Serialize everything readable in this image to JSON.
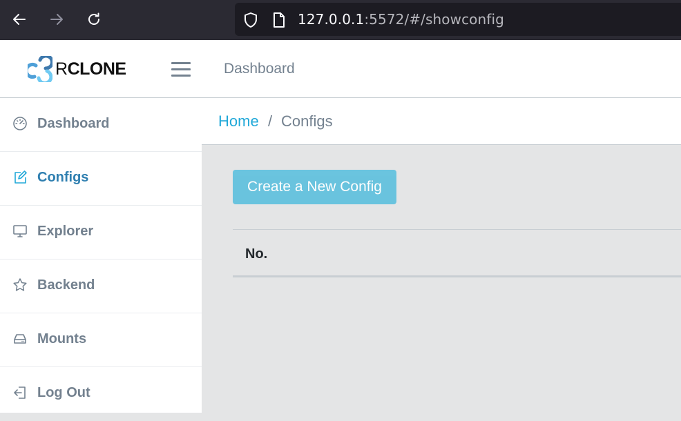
{
  "browser": {
    "url_host": "127.0.0.1",
    "url_rest": ":5572/#/showconfig"
  },
  "header": {
    "brand": {
      "prefix": "R",
      "rest": "CLONE"
    },
    "nav_link": "Dashboard"
  },
  "sidebar": {
    "items": [
      {
        "label": "Dashboard",
        "icon": "speedometer-icon"
      },
      {
        "label": "Configs",
        "icon": "pencil-square-icon",
        "active": true
      },
      {
        "label": "Explorer",
        "icon": "monitor-icon"
      },
      {
        "label": "Backend",
        "icon": "star-icon"
      },
      {
        "label": "Mounts",
        "icon": "hard-drive-icon"
      },
      {
        "label": "Log Out",
        "icon": "logout-icon"
      }
    ]
  },
  "breadcrumb": {
    "home": "Home",
    "separator": "/",
    "current": "Configs"
  },
  "main": {
    "create_button": "Create a New Config",
    "table": {
      "columns": [
        "No."
      ]
    }
  },
  "colors": {
    "accent": "#20a8d8",
    "button": "#63c2de",
    "sidebar_text": "#73818f",
    "active_text": "#2f7fb0",
    "browser_bg": "#2b2a33"
  }
}
